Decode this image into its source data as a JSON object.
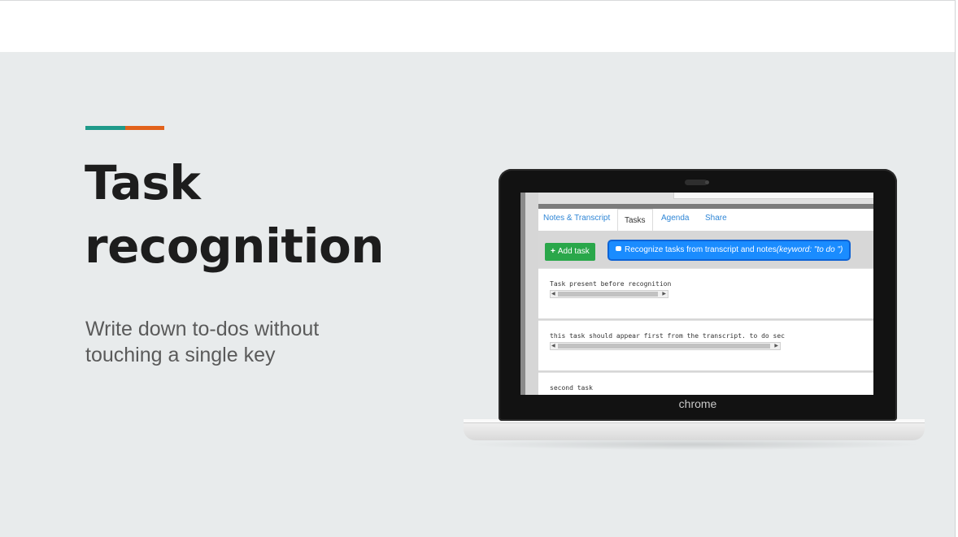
{
  "slide": {
    "title_line1": "Task",
    "title_line2": "recognition",
    "subtitle_line1": "Write down to-dos without",
    "subtitle_line2": "touching a single key",
    "accent_colors": [
      "#1f9a8a",
      "#e2621b"
    ],
    "background": "#e8ebec"
  },
  "laptop": {
    "brand": "chrome"
  },
  "app": {
    "tabs": [
      {
        "label": "Notes & Transcript",
        "active": false
      },
      {
        "label": "Tasks",
        "active": true
      },
      {
        "label": "Agenda",
        "active": false
      },
      {
        "label": "Share",
        "active": false
      }
    ],
    "toolbar": {
      "add_task_label": "Add task",
      "add_task_icon": "plus-icon",
      "recognize_label": "Recognize tasks from transcript and notes",
      "recognize_hint": "(keyword: \"to do \")",
      "recognize_icon": "robot-icon"
    },
    "tasks": [
      {
        "text": "Task present before recognition"
      },
      {
        "text": "this task should appear first from the transcript. to do sec"
      },
      {
        "text": "second task"
      }
    ]
  }
}
